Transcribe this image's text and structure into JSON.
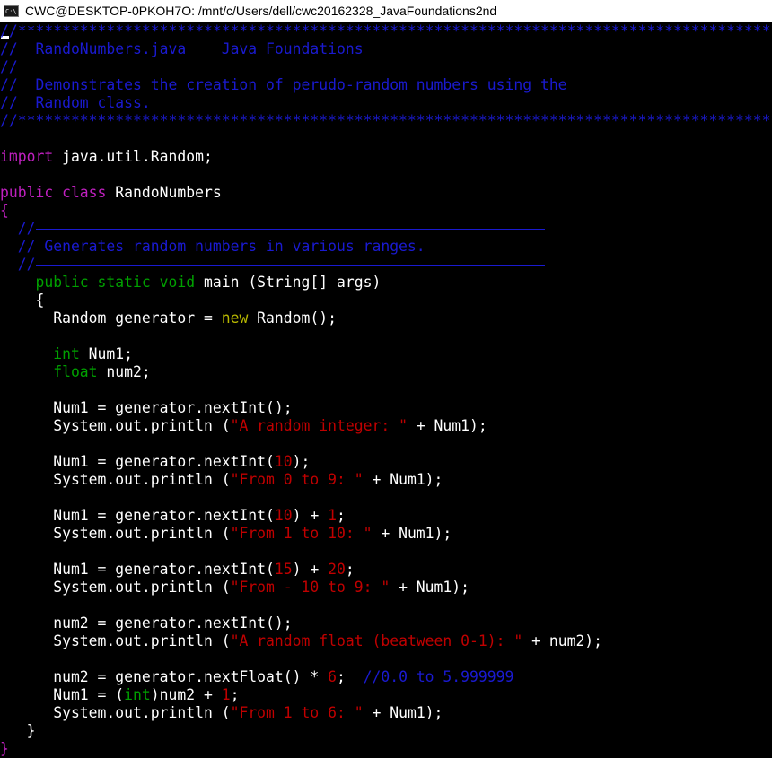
{
  "window": {
    "title": "CWC@DESKTOP-0PKOH7O: /mnt/c/Users/dell/cwc20162328_JavaFoundations2nd",
    "icon": "console-icon",
    "icon_text": "C:\\"
  },
  "colors": {
    "background": "#000000",
    "comment": "#1a1ad0",
    "keyword": "#c020c0",
    "type": "#00a000",
    "new_keyword": "#b8b800",
    "string": "#c00000",
    "text": "#ffffff"
  },
  "editor": {
    "lines": [
      [
        {
          "t": "//********************************************************************************************",
          "c": "c"
        }
      ],
      [
        {
          "t": "//  RandoNumbers.java    Java Foundations",
          "c": "c"
        }
      ],
      [
        {
          "t": "//",
          "c": "c"
        }
      ],
      [
        {
          "t": "//  Demonstrates the creation of perudo-random numbers using the",
          "c": "c"
        }
      ],
      [
        {
          "t": "//  Random class.",
          "c": "c"
        }
      ],
      [
        {
          "t": "//********************************************************************************************",
          "c": "c"
        }
      ],
      [],
      [
        {
          "t": "import",
          "c": "kw"
        },
        {
          "t": " java.util.Random;",
          "c": "pl"
        }
      ],
      [],
      [
        {
          "t": "public class",
          "c": "kw"
        },
        {
          "t": " RandoNumbers",
          "c": "pl"
        }
      ],
      [
        {
          "t": "{",
          "c": "kw"
        }
      ],
      [
        {
          "t": "  //",
          "c": "c"
        }
      ],
      [
        {
          "t": "  // Generates random numbers in various ranges.",
          "c": "c"
        }
      ],
      [
        {
          "t": "  //",
          "c": "c"
        }
      ],
      [
        {
          "t": "    public static void",
          "c": "ty"
        },
        {
          "t": " main (String[] args)",
          "c": "pl"
        }
      ],
      [
        {
          "t": "    {",
          "c": "pl"
        }
      ],
      [
        {
          "t": "      Random generator = ",
          "c": "pl"
        },
        {
          "t": "new",
          "c": "nw"
        },
        {
          "t": " Random();",
          "c": "pl"
        }
      ],
      [],
      [
        {
          "t": "      int",
          "c": "ty"
        },
        {
          "t": " Num1;",
          "c": "pl"
        }
      ],
      [
        {
          "t": "      float",
          "c": "ty"
        },
        {
          "t": " num2;",
          "c": "pl"
        }
      ],
      [],
      [
        {
          "t": "      Num1 = generator.nextInt();",
          "c": "pl"
        }
      ],
      [
        {
          "t": "      System.out.println (",
          "c": "pl"
        },
        {
          "t": "\"A random integer: \"",
          "c": "st"
        },
        {
          "t": " + Num1);",
          "c": "pl"
        }
      ],
      [],
      [
        {
          "t": "      Num1 = generator.nextInt(",
          "c": "pl"
        },
        {
          "t": "10",
          "c": "nm"
        },
        {
          "t": ");",
          "c": "pl"
        }
      ],
      [
        {
          "t": "      System.out.println (",
          "c": "pl"
        },
        {
          "t": "\"From 0 to 9: \"",
          "c": "st"
        },
        {
          "t": " + Num1);",
          "c": "pl"
        }
      ],
      [],
      [
        {
          "t": "      Num1 = generator.nextInt(",
          "c": "pl"
        },
        {
          "t": "10",
          "c": "nm"
        },
        {
          "t": ") + ",
          "c": "pl"
        },
        {
          "t": "1",
          "c": "nm"
        },
        {
          "t": ";",
          "c": "pl"
        }
      ],
      [
        {
          "t": "      System.out.println (",
          "c": "pl"
        },
        {
          "t": "\"From 1 to 10: \"",
          "c": "st"
        },
        {
          "t": " + Num1);",
          "c": "pl"
        }
      ],
      [],
      [
        {
          "t": "      Num1 = generator.nextInt(",
          "c": "pl"
        },
        {
          "t": "15",
          "c": "nm"
        },
        {
          "t": ") + ",
          "c": "pl"
        },
        {
          "t": "20",
          "c": "nm"
        },
        {
          "t": ";",
          "c": "pl"
        }
      ],
      [
        {
          "t": "      System.out.println (",
          "c": "pl"
        },
        {
          "t": "\"From - 10 to 9: \"",
          "c": "st"
        },
        {
          "t": " + Num1);",
          "c": "pl"
        }
      ],
      [],
      [
        {
          "t": "      num2 = generator.nextInt();",
          "c": "pl"
        }
      ],
      [
        {
          "t": "      System.out.println (",
          "c": "pl"
        },
        {
          "t": "\"A random float (beatween 0-1): \"",
          "c": "st"
        },
        {
          "t": " + num2);",
          "c": "pl"
        }
      ],
      [],
      [
        {
          "t": "      num2 = generator.nextFloat() * ",
          "c": "pl"
        },
        {
          "t": "6",
          "c": "nm"
        },
        {
          "t": ";  ",
          "c": "pl"
        },
        {
          "t": "//0.0 to 5.999999",
          "c": "c"
        }
      ],
      [
        {
          "t": "      Num1 = (",
          "c": "pl"
        },
        {
          "t": "int",
          "c": "ty"
        },
        {
          "t": ")num2 + ",
          "c": "pl"
        },
        {
          "t": "1",
          "c": "nm"
        },
        {
          "t": ";",
          "c": "pl"
        }
      ],
      [
        {
          "t": "      System.out.println (",
          "c": "pl"
        },
        {
          "t": "\"From 1 to 6: \"",
          "c": "st"
        },
        {
          "t": " + Num1);",
          "c": "pl"
        }
      ],
      [
        {
          "t": "   }",
          "c": "pl"
        }
      ],
      [
        {
          "t": "}",
          "c": "kw"
        }
      ]
    ]
  }
}
